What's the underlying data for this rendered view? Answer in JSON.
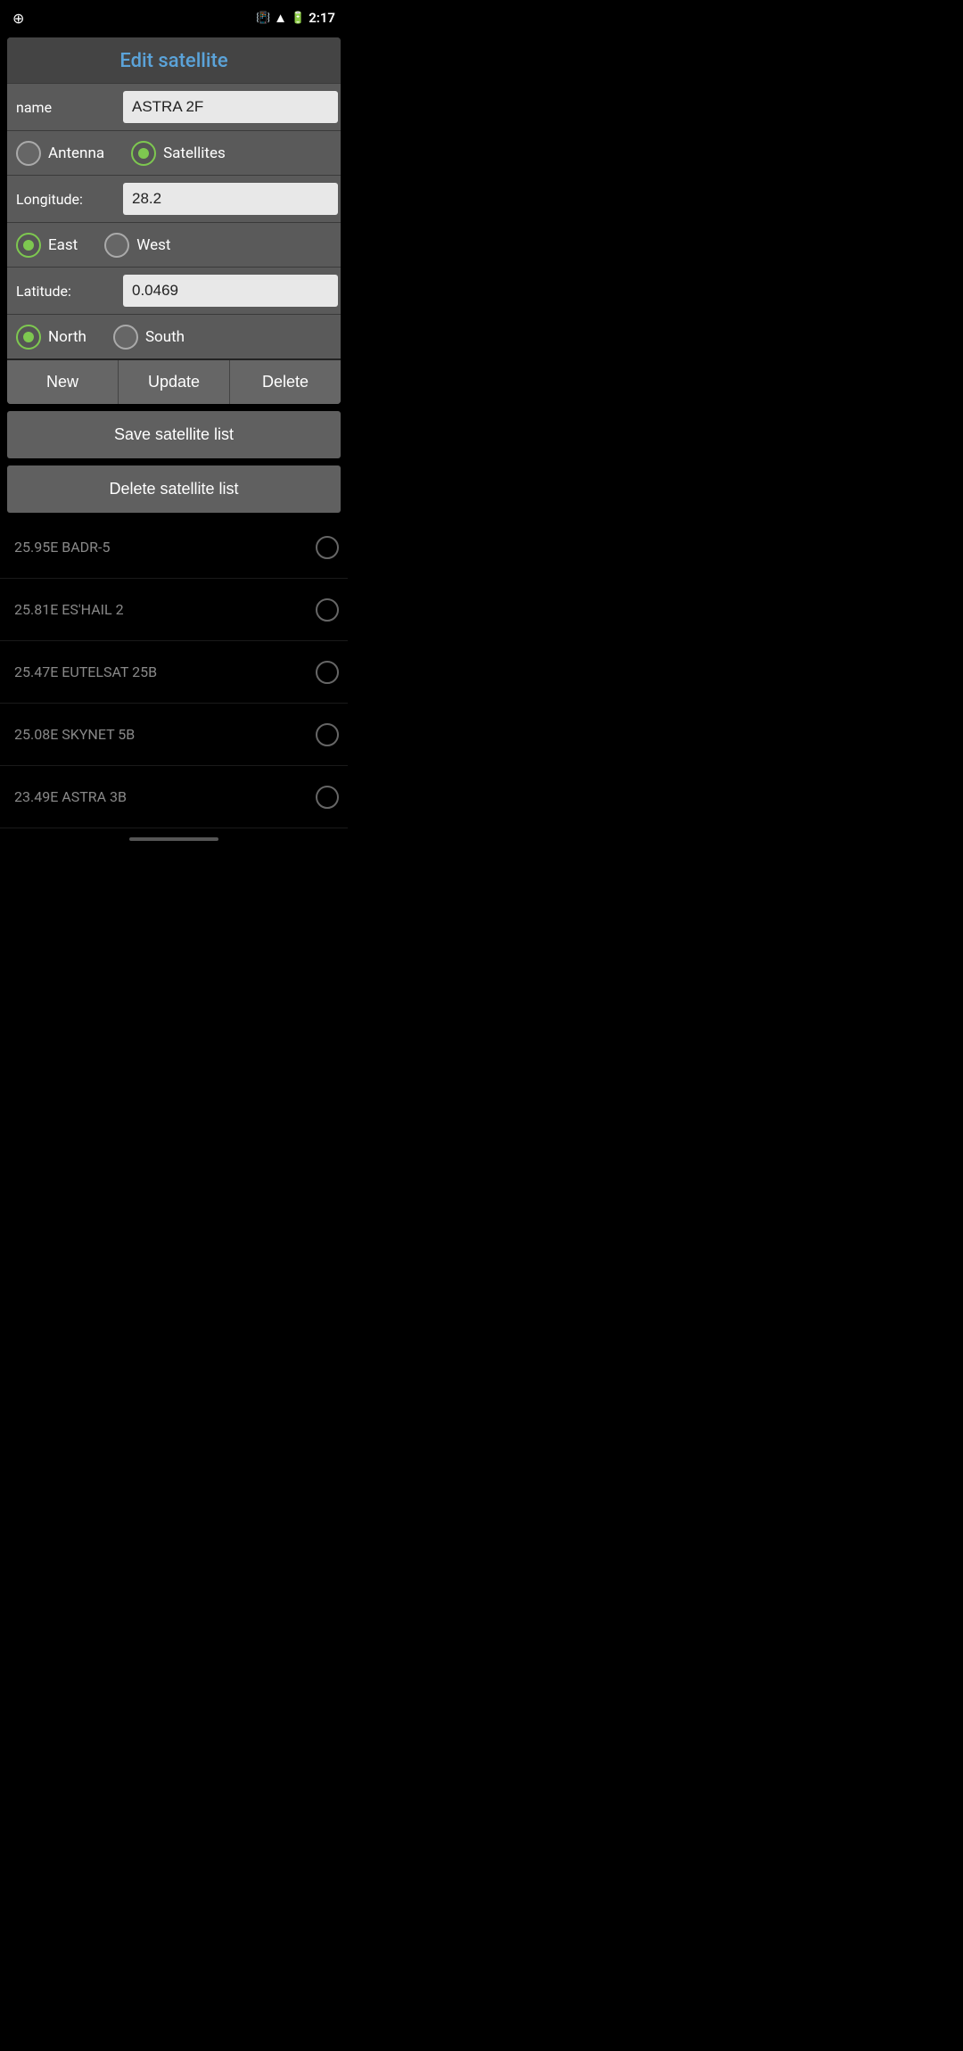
{
  "statusBar": {
    "time": "2:17",
    "ringIcon": "⊕"
  },
  "dialog": {
    "title": "Edit satellite",
    "nameLabel": "name",
    "nameValue": "ASTRA 2F",
    "antennaLabel": "Antenna",
    "satellitesLabel": "Satellites",
    "longitudeLabel": "Longitude:",
    "longitudeValue": "28.2",
    "eastLabel": "East",
    "westLabel": "West",
    "latitudeLabel": "Latitude:",
    "latitudeValue": "0.0469",
    "northLabel": "North",
    "southLabel": "South",
    "newBtn": "New",
    "updateBtn": "Update",
    "deleteBtn": "Delete",
    "saveSatelliteList": "Save satellite list",
    "deleteSatelliteList": "Delete satellite list"
  },
  "satelliteList": [
    {
      "id": "badr5",
      "name": "25.95E BADR-5"
    },
    {
      "id": "eshail2",
      "name": "25.81E ES'HAIL 2"
    },
    {
      "id": "eutelsat25b",
      "name": "25.47E EUTELSAT 25B"
    },
    {
      "id": "skynet5b",
      "name": "25.08E SKYNET 5B"
    },
    {
      "id": "astra3b",
      "name": "23.49E ASTRA 3B"
    }
  ]
}
